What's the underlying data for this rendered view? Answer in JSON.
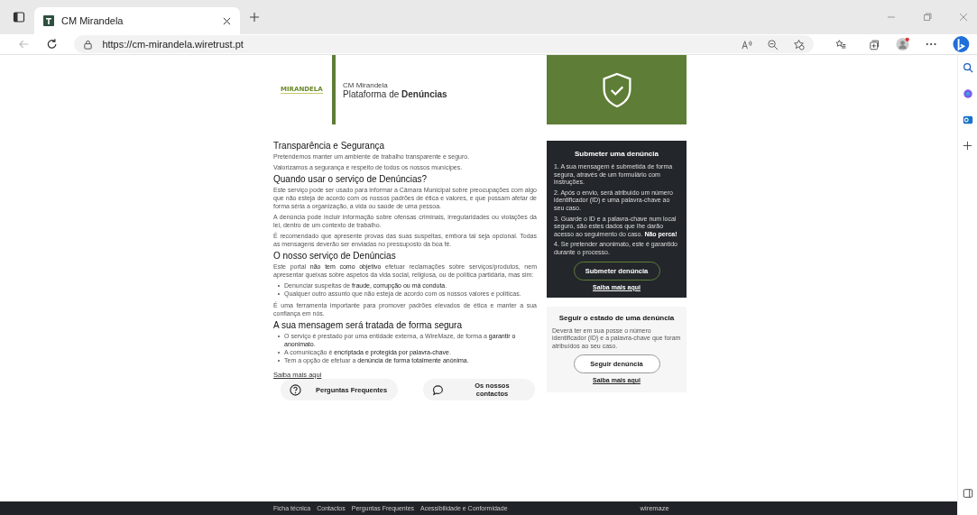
{
  "browser": {
    "tab_title": "CM Mirandela",
    "url": "https://cm-mirandela.wiretrust.pt"
  },
  "header": {
    "logo": "MIRANDELA",
    "org": "CM Mirandela",
    "platform": "Plataforma de **Denúncias**"
  },
  "sections": [
    {
      "heading": "Transparência e Segurança",
      "blocks": [
        {
          "kind": "p",
          "text": "Pretendemos manter um ambiente de trabalho transparente e seguro."
        },
        {
          "kind": "p",
          "text": "Valorizamos a segurança e respeito de todos os nossos munícipes."
        }
      ]
    },
    {
      "heading": "Quando usar o serviço de Denúncias?",
      "blocks": [
        {
          "kind": "p",
          "text": "Este serviço pode ser usado para informar a Câmara Municipal sobre preocupações com algo que não esteja de acordo com os nossos padrões de ética e valores, e que possam afetar de forma séria a organização, a vida ou saúde de uma pessoa."
        },
        {
          "kind": "p",
          "text": "A denúncia pode incluir informação sobre ofensas criminais, irregularidades ou violações da lei, dentro de um contexto de trabalho."
        },
        {
          "kind": "p",
          "text": "É recomendado que apresente provas das suas suspeitas, embora tal seja opcional. Todas as mensagens deverão ser enviadas no pressuposto da boa fé."
        }
      ]
    },
    {
      "heading": "O nosso serviço de Denúncias",
      "blocks": [
        {
          "kind": "p",
          "text": "Este portal **não tem como objetivo** efetuar reclamações sobre serviços/produtos, nem apresentar queixas sobre aspetos da vida social, religiosa, ou de política partidária, mas sim:"
        },
        {
          "kind": "list",
          "items": [
            "Denunciar suspeitas de **fraude, corrupção ou má conduta**.",
            "Qualquer outro assunto que não esteja de acordo com os nossos valores e políticas."
          ]
        },
        {
          "kind": "p",
          "text": "É uma ferramenta importante para promover padrões elevados de ética e manter a sua confiança em nós."
        }
      ]
    },
    {
      "heading": "A sua mensagem será tratada de forma segura",
      "blocks": [
        {
          "kind": "list",
          "items": [
            "O serviço é prestado por uma entidade externa, a WireMaze, de forma a **garantir o anonimato**.",
            "A comunicação é **encriptada e protegida por palavra-chave**.",
            "Tem a opção de efetuar a **denúncia de forma totalmente anónima**."
          ]
        }
      ]
    }
  ],
  "more_link": "Saiba mais aqui",
  "quick_buttons": [
    {
      "kind": "faq",
      "label": "Perguntas Frequentes"
    },
    {
      "kind": "contact",
      "label": "Os nossos contactos"
    }
  ],
  "submit_card": {
    "title": "Submeter uma denúncia",
    "steps": [
      "1. A sua mensagem é submetida de forma segura, através de um formulário com instruções.",
      "2. Após o envio, será atribuído um número identificador (ID) e uma palavra-chave ao seu caso.",
      "3. Guarde o ID e a palavra-chave num local seguro, são estes dados que lhe darão acesso ao seguimento do caso. **Não perca!**",
      "4. Se pretender anonimato, este é garantido durante o processo."
    ],
    "button": "Submeter denúncia",
    "link": "Saiba mais aqui"
  },
  "follow_card": {
    "title": "Seguir o estado de uma denúncia",
    "text": "Deverá ter em sua posse o número identificador (ID) e a palavra-chave que foram atribuídos ao seu caso.",
    "button": "Seguir denúncia",
    "link": "Saiba mais aqui"
  },
  "footer": {
    "links": [
      "Ficha técnica",
      "Contactos",
      "Perguntas Frequentes",
      "Acessibilidade e Conformidade"
    ],
    "brand": "wiremaze"
  }
}
